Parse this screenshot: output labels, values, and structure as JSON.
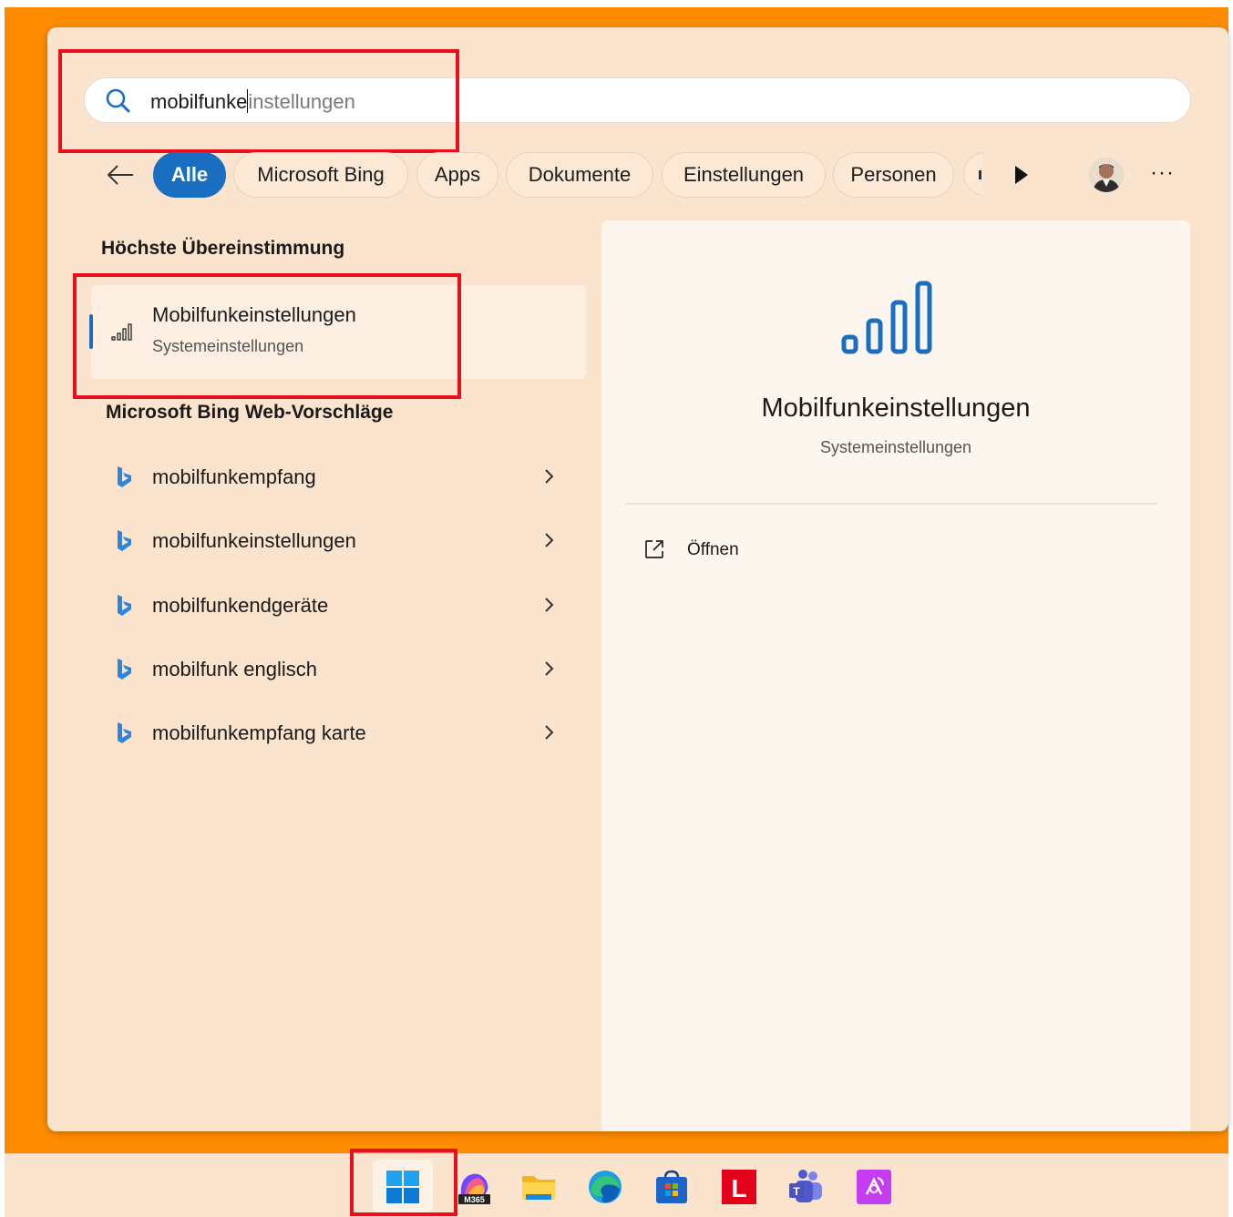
{
  "search": {
    "typed": "mobilfunke",
    "completion": "instellungen"
  },
  "filters": {
    "back_label": "←",
    "chips": [
      "Alle",
      "Microsoft Bing",
      "Apps",
      "Dokumente",
      "Einstellungen",
      "Personen"
    ],
    "active": "Alle",
    "more_label": "···"
  },
  "best_match": {
    "section_title": "Höchste Übereinstimmung",
    "title": "Mobilfunkeinstellungen",
    "subtitle": "Systemeinstellungen"
  },
  "web": {
    "section_title": "Microsoft Bing Web-Vorschläge",
    "items": [
      "mobilfunkempfang",
      "mobilfunkeinstellungen",
      "mobilfunkendgeräte",
      "mobilfunk englisch",
      "mobilfunkempfang karte"
    ]
  },
  "detail": {
    "title": "Mobilfunkeinstellungen",
    "subtitle": "Systemeinstellungen",
    "open_label": "Öffnen"
  },
  "taskbar": {
    "m365_badge": "M365",
    "lexware_letter": "L",
    "items": [
      "start-icon",
      "m365-copilot-icon",
      "file-explorer-icon",
      "edge-icon",
      "microsoft-store-icon",
      "lexware-icon",
      "teams-icon",
      "remote-app-icon"
    ]
  },
  "colors": {
    "desktop": "#ff8c00",
    "panel": "#fbe4cd",
    "accent": "#1a6ec0",
    "highlight": "#e8101e"
  }
}
